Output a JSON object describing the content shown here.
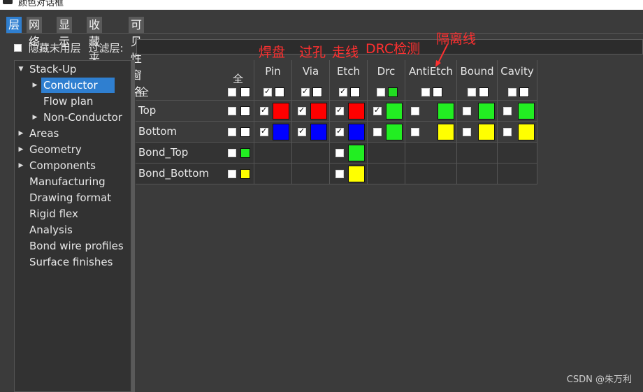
{
  "window": {
    "title": "颜色对话框"
  },
  "tabs": [
    {
      "label": "层",
      "active": true
    },
    {
      "label": "网络",
      "active": false
    },
    {
      "label": "显示",
      "active": false
    },
    {
      "label": "收藏夹",
      "active": false
    },
    {
      "label": "可见性窗格",
      "active": false
    }
  ],
  "options": {
    "hide_unused_label": "隐藏未用层",
    "filter_label": "过滤层:",
    "filter_value": ""
  },
  "tree": [
    {
      "label": "Stack-Up",
      "arrow": "down"
    },
    {
      "label": "Conductor",
      "arrow": "right",
      "selected": true
    },
    {
      "label": "Flow plan",
      "arrow": ""
    },
    {
      "label": "Non-Conductor",
      "arrow": "right"
    },
    {
      "label": "Areas",
      "arrow": "right"
    },
    {
      "label": "Geometry",
      "arrow": "right"
    },
    {
      "label": "Components",
      "arrow": "right"
    },
    {
      "label": "Manufacturing",
      "arrow": ""
    },
    {
      "label": "Drawing format",
      "arrow": ""
    },
    {
      "label": "Rigid flex",
      "arrow": ""
    },
    {
      "label": "Analysis",
      "arrow": ""
    },
    {
      "label": "Bond wire profiles",
      "arrow": ""
    },
    {
      "label": "Surface finishes",
      "arrow": ""
    }
  ],
  "grid": {
    "all_label": "全",
    "all_header": "全",
    "columns": [
      "Pin",
      "Via",
      "Etch",
      "Drc",
      "AntiEtch",
      "Bound",
      "Cavity"
    ],
    "header_swatches": [
      "#ffffff",
      "#ffffff",
      "#ffffff",
      "#22dd22",
      "#ffffff",
      "#ffffff",
      "#ffffff"
    ],
    "rows": [
      {
        "label": "Top",
        "all_swatch": "#ffffff",
        "cells": [
          {
            "checked": true,
            "color": "#ff0000"
          },
          {
            "checked": true,
            "color": "#ff0000"
          },
          {
            "checked": true,
            "color": "#ff0000"
          },
          {
            "checked": true,
            "color": "#22ee22"
          },
          {
            "checked": false,
            "color": "#22ee22"
          },
          {
            "checked": false,
            "color": "#22ee22"
          },
          {
            "checked": false,
            "color": "#22ee22"
          }
        ]
      },
      {
        "label": "Bottom",
        "all_swatch": "#ffffff",
        "cells": [
          {
            "checked": true,
            "color": "#0000ff"
          },
          {
            "checked": true,
            "color": "#0000ff"
          },
          {
            "checked": true,
            "color": "#0000ff"
          },
          {
            "checked": false,
            "color": "#22ee22"
          },
          {
            "checked": false,
            "color": "#ffff00"
          },
          {
            "checked": false,
            "color": "#ffff00"
          },
          {
            "checked": false,
            "color": "#ffff00"
          }
        ]
      },
      {
        "label": "Bond_Top",
        "all_swatch": "#22ee22",
        "cells": [
          null,
          null,
          {
            "checked": false,
            "color": "#22ee22"
          },
          null,
          null,
          null,
          null
        ]
      },
      {
        "label": "Bond_Bottom",
        "all_swatch": "#ffff00",
        "cells": [
          null,
          null,
          {
            "checked": false,
            "color": "#ffff00"
          },
          null,
          null,
          null,
          null
        ]
      }
    ]
  },
  "annotations": {
    "pad": "焊盘",
    "via": "过孔",
    "trace": "走线",
    "drc": "DRC检测",
    "antietch": "隔离线"
  },
  "watermark": "CSDN @朱万利"
}
